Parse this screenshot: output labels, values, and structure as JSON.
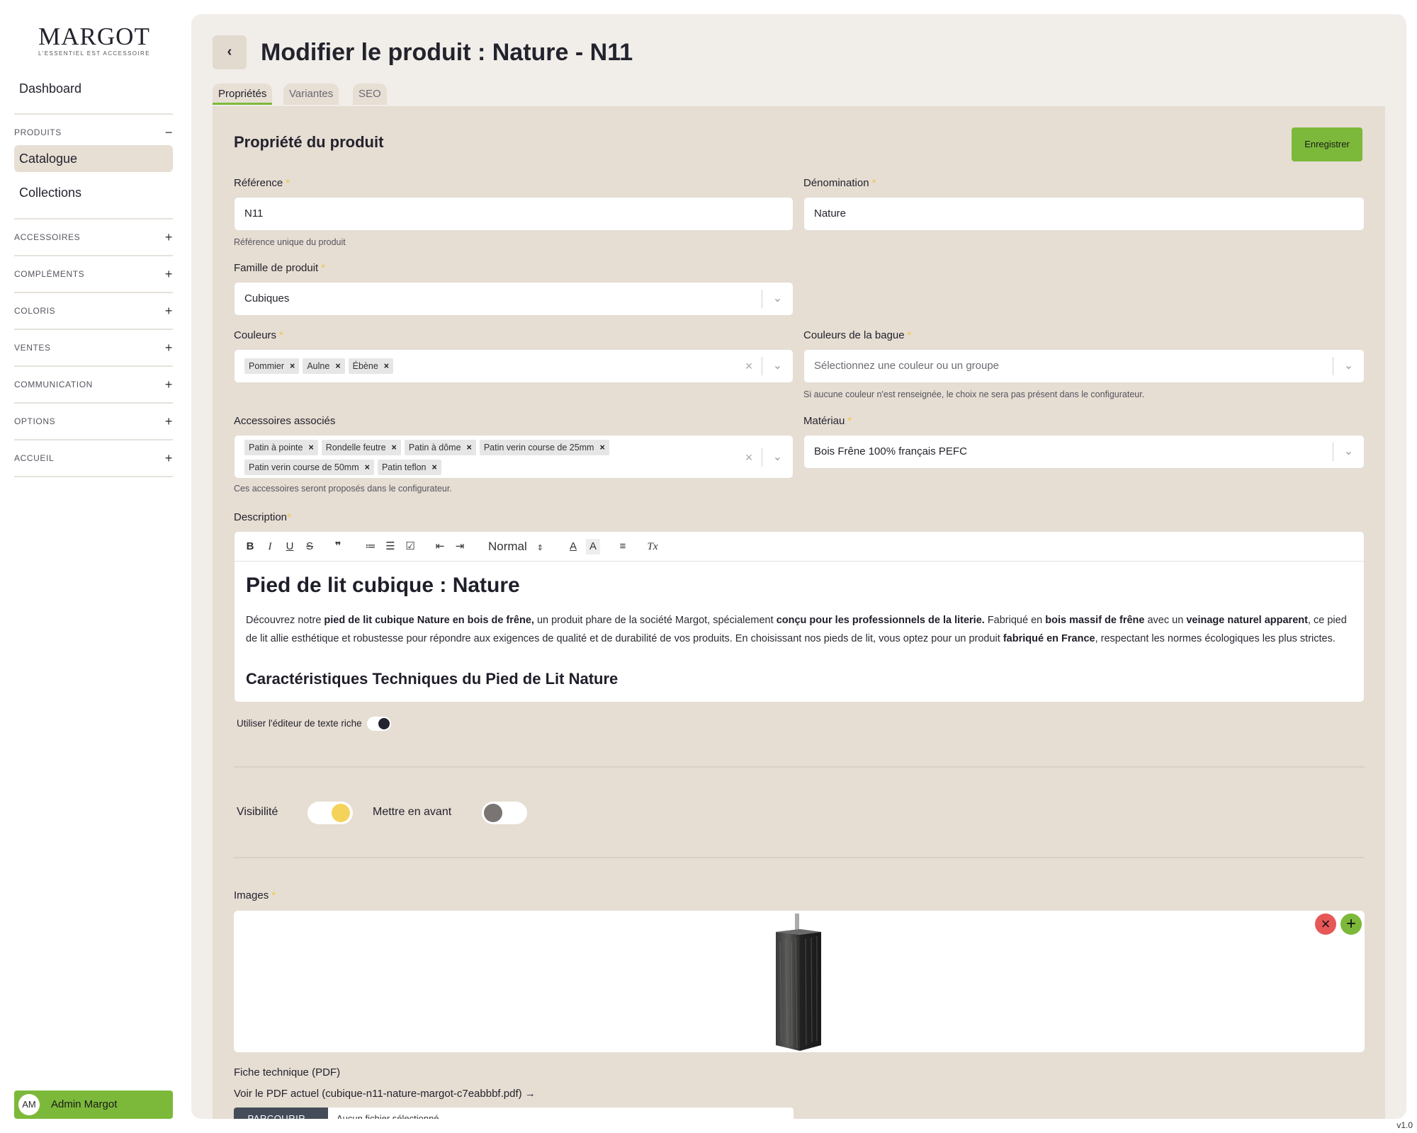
{
  "brand": {
    "name": "MARGOT",
    "tagline": "L'ESSENTIEL EST ACCESSOIRE"
  },
  "sidebar": {
    "dashboard": "Dashboard",
    "sections": [
      {
        "label": "PRODUITS",
        "toggle": "−",
        "items": [
          "Catalogue",
          "Collections"
        ]
      },
      {
        "label": "ACCESSOIRES",
        "toggle": "+"
      },
      {
        "label": "COMPLÉMENTS",
        "toggle": "+"
      },
      {
        "label": "COLORIS",
        "toggle": "+"
      },
      {
        "label": "VENTES",
        "toggle": "+"
      },
      {
        "label": "COMMUNICATION",
        "toggle": "+"
      },
      {
        "label": "OPTIONS",
        "toggle": "+"
      },
      {
        "label": "ACCUEIL",
        "toggle": "+"
      }
    ],
    "active_item": "Catalogue",
    "user": {
      "initials": "AM",
      "name": "Admin Margot"
    }
  },
  "header": {
    "back_icon": "chevron-left-icon",
    "back_glyph": "‹",
    "title": "Modifier le produit : Nature - N11",
    "tabs": [
      "Propriétés",
      "Variantes",
      "SEO"
    ],
    "active_tab": "Propriétés"
  },
  "form": {
    "section_title": "Propriété du produit",
    "save_label": "Enregistrer",
    "required_mark": "*",
    "reference": {
      "label": "Référence",
      "value": "N11",
      "help": "Référence unique du produit"
    },
    "denomination": {
      "label": "Dénomination",
      "value": "Nature"
    },
    "famille": {
      "label": "Famille de produit",
      "value": "Cubiques"
    },
    "couleurs": {
      "label": "Couleurs",
      "chips": [
        "Pommier",
        "Aulne",
        "Ébène"
      ]
    },
    "couleurs_bague": {
      "label": "Couleurs de la bague",
      "placeholder": "Sélectionnez une couleur ou un groupe",
      "help": "Si aucune couleur n'est renseignée, le choix ne sera pas présent dans le configurateur."
    },
    "accessoires": {
      "label": "Accessoires associés",
      "chips_row1": [
        "Patin à pointe",
        "Rondelle feutre",
        "Patin à dôme",
        "Patin verin course de 25mm"
      ],
      "chips_row2": [
        "Patin verin course de 50mm",
        "Patin teflon"
      ],
      "help": "Ces accessoires seront proposés dans le configurateur."
    },
    "materiau": {
      "label": "Matériau",
      "value": "Bois Frêne 100% français PEFC"
    },
    "description": {
      "label": "Description",
      "toolbar": {
        "bold": "B",
        "italic": "I",
        "underline": "U",
        "strike": "S",
        "quote": "❞",
        "ordered_list": "≔",
        "bullet_list": "☰",
        "check_list": "☑",
        "outdent": "⇤",
        "indent": "⇥",
        "heading_select": "Normal",
        "text_color": "A",
        "highlight": "A",
        "align": "≡",
        "clear_format": "Tx"
      },
      "heading": "Pied de lit cubique : Nature",
      "p_1": "Découvrez notre ",
      "p_2": "pied de lit cubique Nature en bois de frêne,",
      "p_3": " un produit phare de la société Margot, spécialement ",
      "p_4": "conçu pour les professionnels de la literie.",
      "p_5": " Fabriqué en ",
      "p_6": "bois massif de frêne",
      "p_7": " avec un ",
      "p_8": "veinage naturel apparent",
      "p_9": ", ce pied de lit allie esthétique et robustesse pour répondre aux exigences de qualité et de durabilité de vos produits. En choisissant nos pieds de lit, vous optez pour un produit ",
      "p_10": "fabriqué en France",
      "p_11": ", respectant les normes écologiques les plus strictes.",
      "subheading": "Caractéristiques Techniques du Pied de Lit Nature"
    },
    "rich_editor_toggle": "Utiliser l'éditeur de texte riche",
    "visibilite": {
      "label": "Visibilité",
      "on": true
    },
    "mettre_en_avant": {
      "label": "Mettre en avant",
      "on": false
    },
    "images": {
      "label": "Images"
    },
    "fiche_technique": {
      "label": "Fiche technique (PDF)",
      "link": "Voir le PDF actuel (cubique-n11-nature-margot-c7eabbbf.pdf) →",
      "browse": "PARCOURIR...",
      "no_file": "Aucun fichier sélectionné."
    }
  },
  "version": "v1.0",
  "colors": {
    "accent_green": "#7cb93a",
    "toggle_yellow": "#f5d35a",
    "danger_red": "#e75757",
    "panel": "#e6ddd3"
  }
}
